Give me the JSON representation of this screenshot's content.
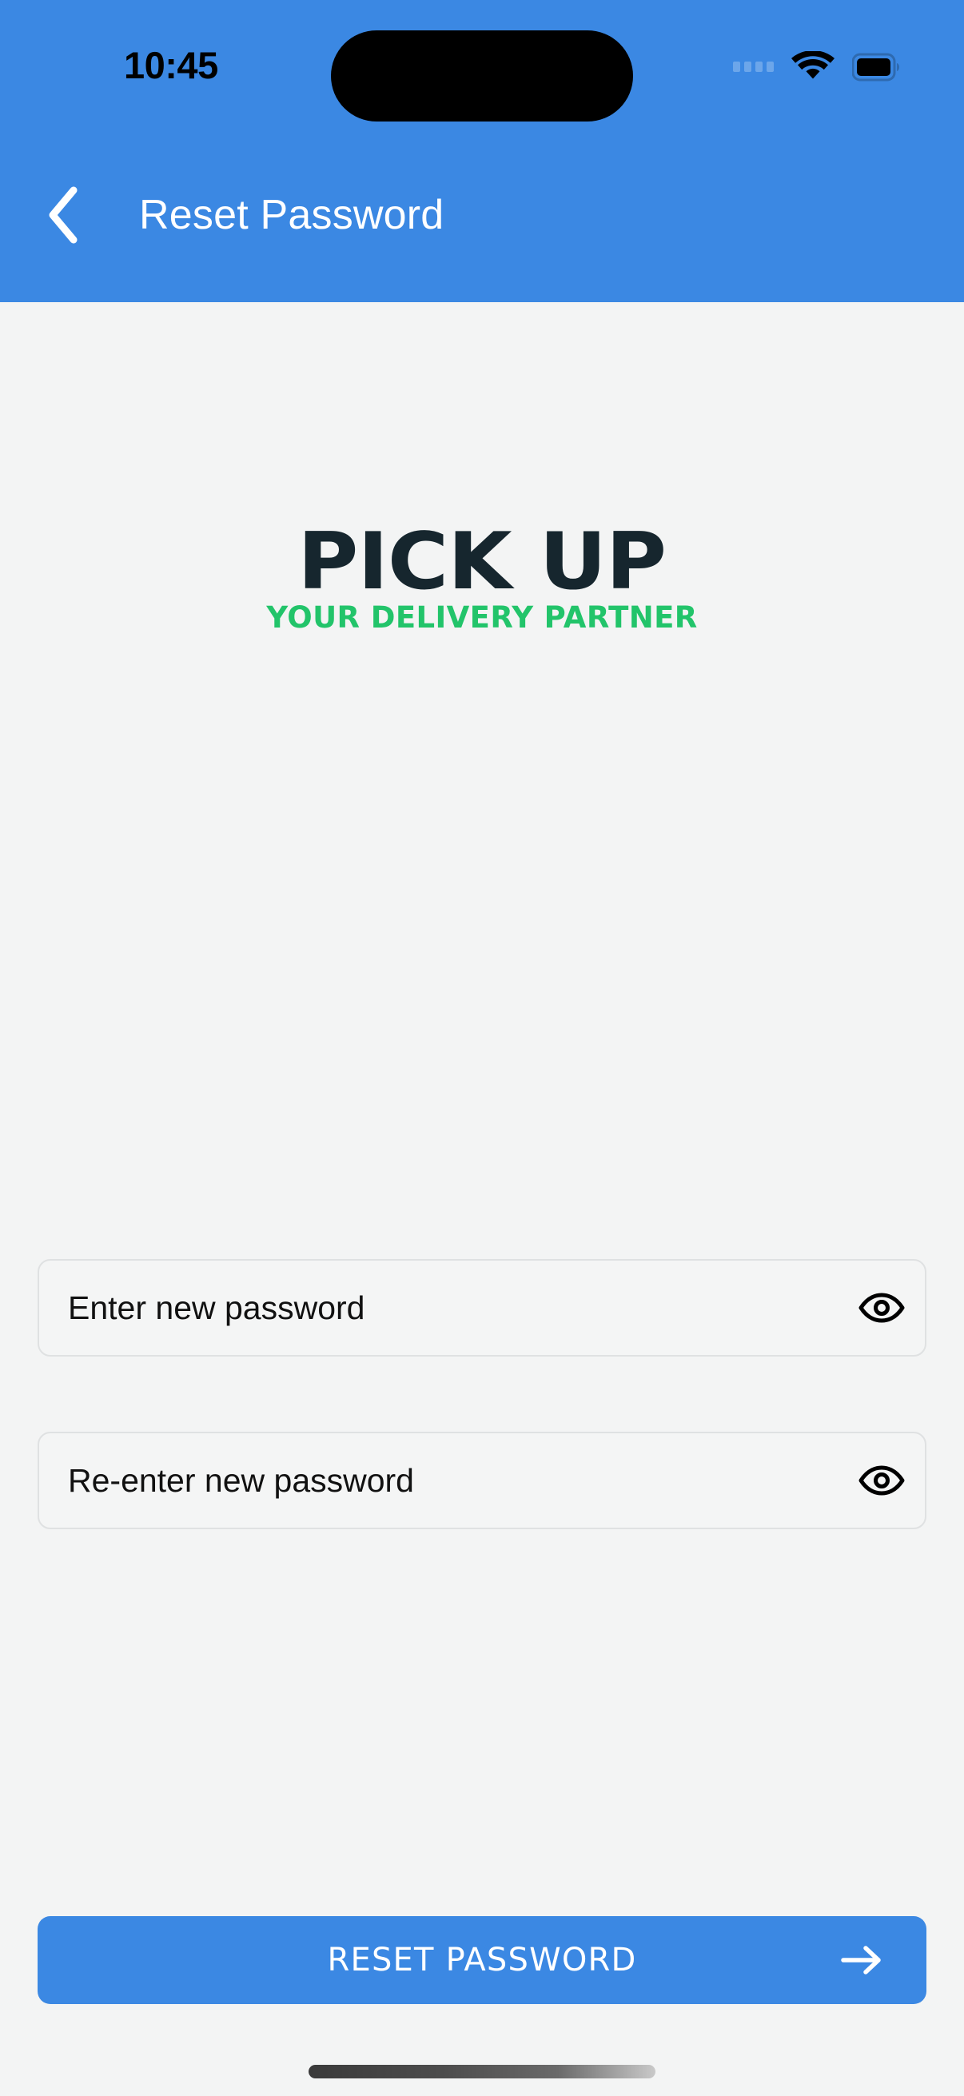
{
  "statusbar": {
    "time": "10:45",
    "signal_icon": "signal-dots-icon",
    "wifi_icon": "wifi-icon",
    "battery_icon": "battery-full-icon"
  },
  "navbar": {
    "back_icon": "chevron-left-icon",
    "title": "Reset Password",
    "background_color": "#3b88e3",
    "title_color": "#ffffff"
  },
  "logo": {
    "main": "PICK UP",
    "tagline": "YOUR DELIVERY PARTNER",
    "main_color": "#16262e",
    "tagline_color": "#22c46a"
  },
  "form": {
    "fields": [
      {
        "name": "new-password",
        "placeholder": "Enter new password",
        "value": "",
        "toggle_icon": "eye-icon"
      },
      {
        "name": "confirm-password",
        "placeholder": "Re-enter new password",
        "value": "",
        "toggle_icon": "eye-icon"
      }
    ]
  },
  "footer": {
    "submit_label": "RESET PASSWORD",
    "submit_icon": "arrow-right-icon",
    "submit_color": "#3b88e3"
  },
  "theme": {
    "accent": "#3b88e3",
    "background": "#f3f4f4",
    "green": "#22c46a",
    "dark": "#16262e"
  }
}
